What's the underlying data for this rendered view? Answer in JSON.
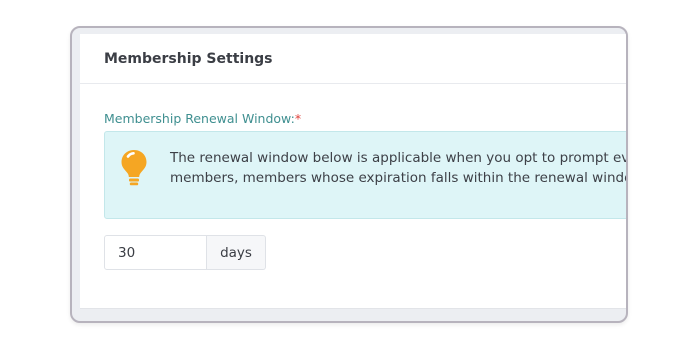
{
  "card": {
    "title": "Membership Settings"
  },
  "renewal": {
    "label": "Membership Renewal Window:",
    "required_marker": "*",
    "info_icon": "lightbulb-icon",
    "info_line_1": "The renewal window below is applicable when you opt to prompt ev",
    "info_line_2": "members, members whose expiration falls within the renewal windo",
    "value": "30",
    "unit": "days"
  },
  "colors": {
    "label": "#3f8f90",
    "required": "#e0413b",
    "info_background": "#def5f7",
    "bulb": "#f5a623"
  }
}
